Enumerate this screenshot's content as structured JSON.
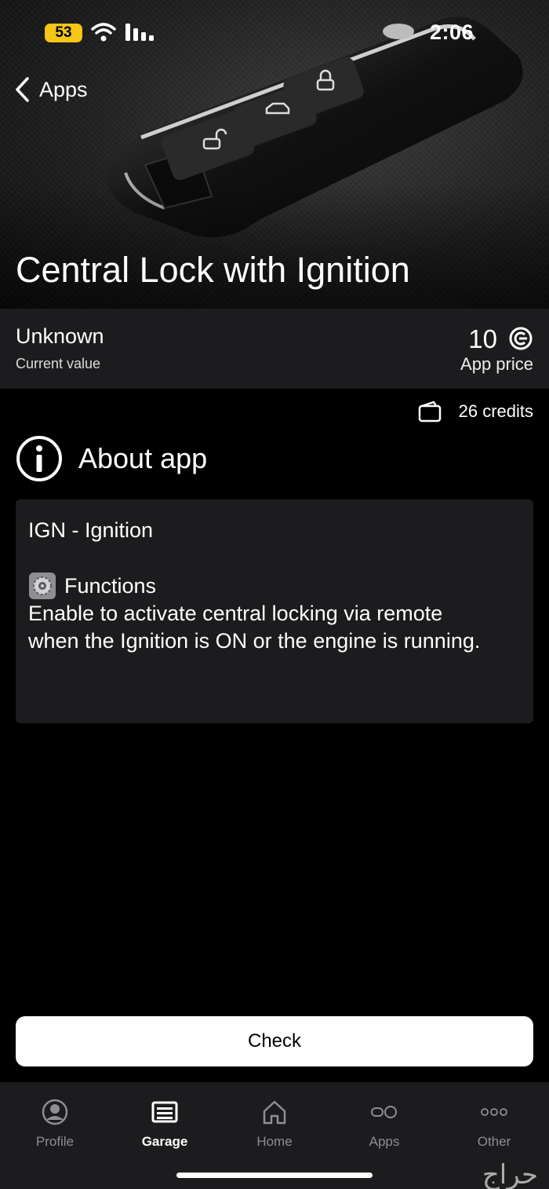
{
  "status_bar": {
    "battery": "53",
    "time": "2:06"
  },
  "nav": {
    "back_label": "Apps"
  },
  "hero": {
    "title": "Central Lock with Ignition"
  },
  "info": {
    "value": "Unknown",
    "value_caption": "Current value",
    "price": "10",
    "price_caption": "App price"
  },
  "credits": {
    "text": "26 credits"
  },
  "about": {
    "title": "About app",
    "line1": "IGN - Ignition",
    "functions_icon": "⚙️",
    "functions_label": "Functions",
    "description_line1": "Enable to activate central locking via remote",
    "description_line2": "when the Ignition is ON or the engine is running."
  },
  "actions": {
    "check_label": "Check"
  },
  "tabs": [
    {
      "label": "Profile",
      "icon": "person-icon"
    },
    {
      "label": "Garage",
      "icon": "garage-icon"
    },
    {
      "label": "Home",
      "icon": "house-icon"
    },
    {
      "label": "Apps",
      "icon": "apps-icon"
    },
    {
      "label": "Other",
      "icon": "more-icon"
    }
  ],
  "watermark": "حراج",
  "colors": {
    "battery": "#f5c518",
    "background": "#000000",
    "card": "#1c1c1e"
  }
}
